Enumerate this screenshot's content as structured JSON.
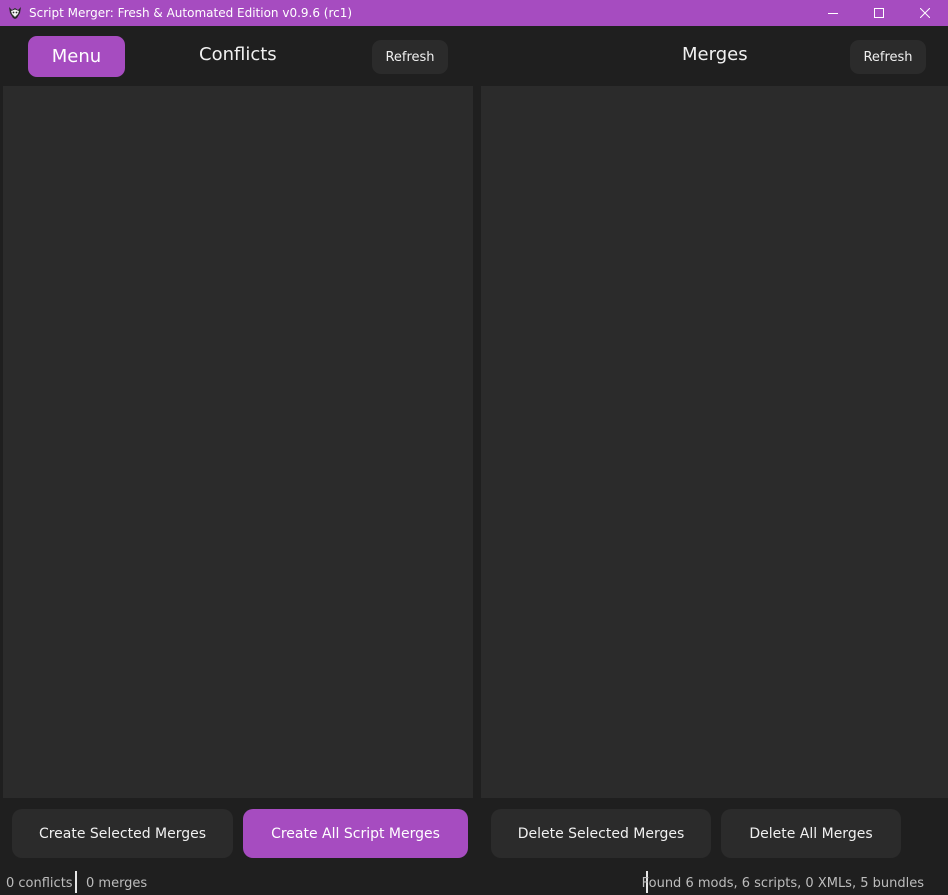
{
  "window": {
    "title": "Script Merger: Fresh & Automated Edition v0.9.6 (rc1)",
    "icon": "wolf-icon",
    "controls": [
      "minimize-icon",
      "maximize-icon",
      "close-icon"
    ]
  },
  "header": {
    "menu_label": "Menu",
    "conflicts_label": "Conflicts",
    "conflicts_refresh_label": "Refresh",
    "merges_label": "Merges",
    "merges_refresh_label": "Refresh"
  },
  "actions": {
    "create_selected_label": "Create Selected Merges",
    "create_all_label": "Create All Script Merges",
    "delete_selected_label": "Delete Selected Merges",
    "delete_all_label": "Delete All Merges"
  },
  "status": {
    "conflicts": "0 conflicts",
    "merges": "0 merges",
    "found": "Found 6 mods, 6 scripts, 0 XMLs, 5 bundles"
  },
  "colors": {
    "accent": "#a64cc0",
    "background": "#1f1f1f",
    "panel": "#2b2b2b",
    "button": "#2b2b2b"
  }
}
